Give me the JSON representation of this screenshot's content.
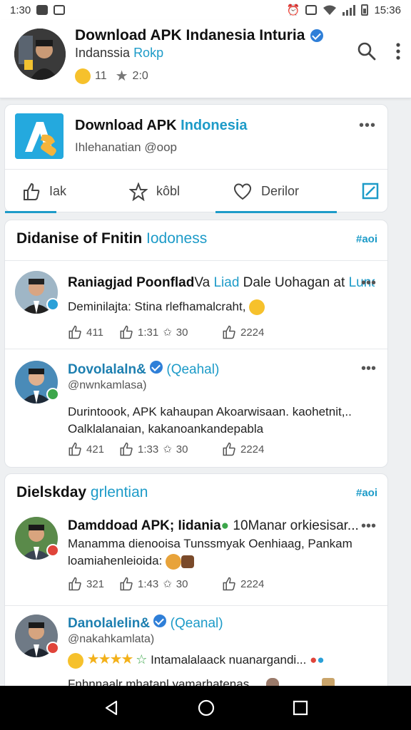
{
  "status_bar": {
    "time": "1:30",
    "right_time": "15:36"
  },
  "header": {
    "title": "Download APK Indanesia Inturia",
    "subtitle_prefix": "Indanssia ",
    "subtitle_accent": "Rokp",
    "likes": "11",
    "rating": "2:0",
    "icons": [
      "search-icon",
      "more-vert-icon"
    ]
  },
  "page_card": {
    "title_prefix": "Download APK ",
    "title_accent": "Indonesia",
    "subtitle": "Ihlehanatian @oop",
    "tabs": [
      {
        "label": "Iak",
        "icon": "thumbs-up-icon",
        "active": true
      },
      {
        "label": "kôbl",
        "icon": "star-icon",
        "active": false
      },
      {
        "label": "Derilor",
        "icon": "heart-icon",
        "active": true
      }
    ]
  },
  "sections": [
    {
      "title_prefix": "Didanise of Fnitin ",
      "title_accent": "Iodoness",
      "link": "#aoi",
      "posts": [
        {
          "name": "Raniagjad Poonflad",
          "name_second": "Va ",
          "name_accent": "Liad",
          "name_rest": " Dale Uohagan at ",
          "name_tail": "Lunac",
          "text_lines": [
            "Deminilajta: Stina rlefhamalcraht,"
          ],
          "likes": "411",
          "shares": "1:31",
          "rating": "30",
          "comments": "2224",
          "badge_color": "#2aa0d8"
        },
        {
          "name": "Dovolalaln&",
          "name_accent": "(Qeahal)",
          "handle": "@nwnkamlasa)",
          "text_lines": [
            "Durintoook, APK kahaupan Akoarwisaan. kaohetnit,..",
            "Oalklalanaian, kakanoankandepabla"
          ],
          "likes": "421",
          "shares": "1:33",
          "rating": "30",
          "comments": "2224",
          "badge_color": "#3ca64a"
        }
      ]
    },
    {
      "title_prefix": "Dielskday ",
      "title_accent": "grlentian",
      "link": "#aoi",
      "posts": [
        {
          "name": "Damddoad APK; Iidania",
          "name_rest": " 10Manar orkiesisar...",
          "text_lines": [
            "Manamma dienooisa Tunssmyak Oenhiaag, Pankam",
            "loamiahenleioida:"
          ],
          "likes": "321",
          "shares": "1:43",
          "rating": "30",
          "comments": "2224",
          "badge_color": "#e0443a"
        },
        {
          "name": "Danolalelin&",
          "name_accent": "(Qeanal)",
          "handle": "@nakahkamlata)",
          "text_lines": [
            "Intamalalaack nuanargandi...",
            "Fnhnnaalr mhatanl yamarhatenas."
          ],
          "badge_color": "#e0443a"
        }
      ]
    }
  ],
  "nav": [
    "back-icon",
    "home-icon",
    "recents-icon"
  ],
  "colors": {
    "accent": "#1d9bc8",
    "star": "#f3b11a",
    "verified": "#2f7fd8"
  }
}
